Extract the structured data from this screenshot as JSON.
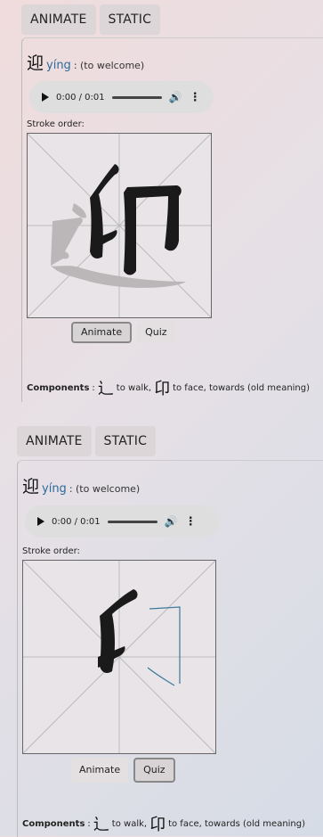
{
  "tabs": [
    "ANIMATE",
    "STATIC"
  ],
  "entry": {
    "character": "迎",
    "pinyin": "yíng",
    "meaning": " : (to welcome)"
  },
  "audio": {
    "time": "0:00 / 0:01"
  },
  "stroke_order_label": "Stroke order:",
  "buttons": {
    "animate": "Animate",
    "quiz": "Quiz"
  },
  "components": {
    "label": "Components",
    "items": [
      {
        "char": "辶",
        "meaning": "to walk,"
      },
      {
        "char": "卬",
        "meaning": "to face, towards (old meaning)"
      }
    ]
  },
  "icons": [
    "play-icon",
    "volume-icon",
    "more-options-icon"
  ]
}
